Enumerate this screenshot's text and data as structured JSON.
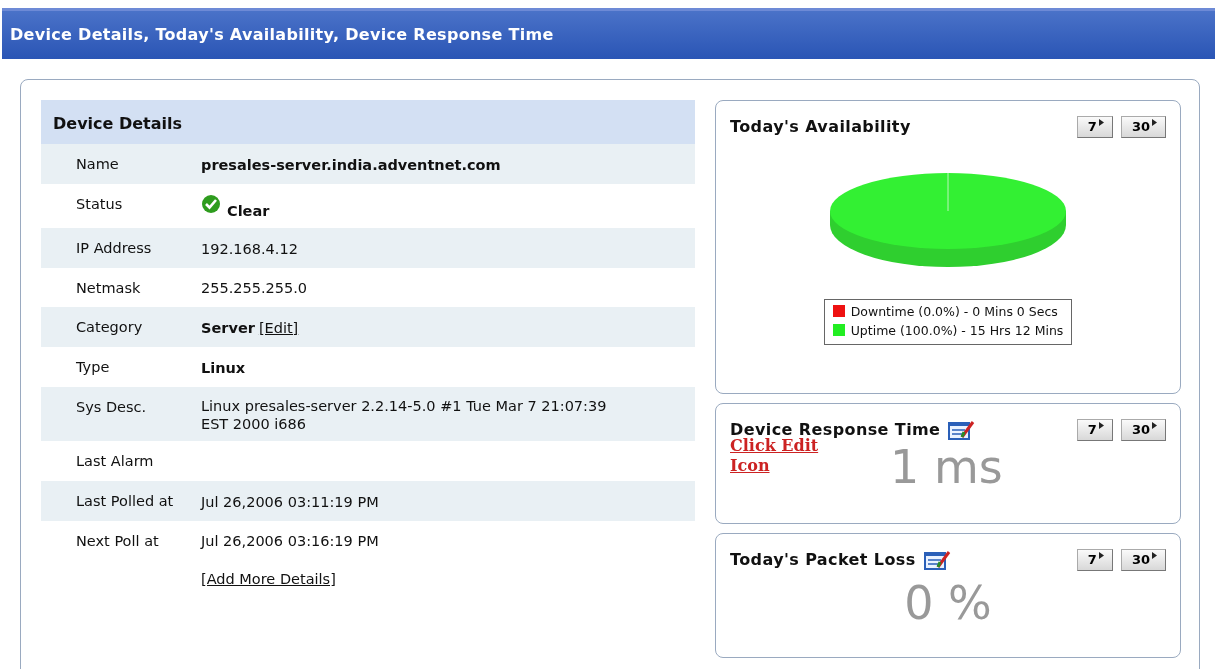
{
  "window": {
    "title": "Device Details, Today's Availability, Device Response Time"
  },
  "device_details": {
    "title": "Device Details",
    "rows": [
      {
        "label": "Name",
        "value": "presales-server.india.adventnet.com",
        "kind": "bold"
      },
      {
        "label": "Status",
        "value": "Clear",
        "kind": "status"
      },
      {
        "label": "IP Address",
        "value": "192.168.4.12",
        "kind": "plain"
      },
      {
        "label": "Netmask",
        "value": "255.255.255.0",
        "kind": "plain"
      },
      {
        "label": "Category",
        "value": "Server",
        "link": "[Edit]",
        "kind": "category"
      },
      {
        "label": "Type",
        "value": "Linux",
        "kind": "bold"
      },
      {
        "label": "Sys Desc.",
        "value": "Linux presales-server 2.2.14-5.0 #1 Tue Mar 7 21:07:39 EST 2000 i686",
        "kind": "plain"
      },
      {
        "label": "Last Alarm",
        "kind": "empty"
      },
      {
        "label": "Last Polled at",
        "value": "Jul 26,2006 03:11:19 PM",
        "kind": "plain"
      },
      {
        "label": "Next Poll at",
        "value": "Jul 26,2006 03:16:19 PM",
        "kind": "plain"
      }
    ],
    "add_link": "[Add More Details]"
  },
  "availability": {
    "title": "Today's Availability",
    "buttons": [
      "7",
      "30"
    ],
    "legend": [
      {
        "text": "Downtime (0.0%) - 0 Mins 0 Secs",
        "color": "#ee1111"
      },
      {
        "text": "Uptime (100.0%) - 15 Hrs 12 Mins",
        "color": "#22ee22"
      }
    ]
  },
  "response_time": {
    "title": "Device Response Time",
    "buttons": [
      "7",
      "30"
    ],
    "hint": "Click Edit Icon",
    "value": "1 ms"
  },
  "packet_loss": {
    "title": "Today's Packet Loss",
    "buttons": [
      "7",
      "30"
    ],
    "value": "0 %"
  }
}
